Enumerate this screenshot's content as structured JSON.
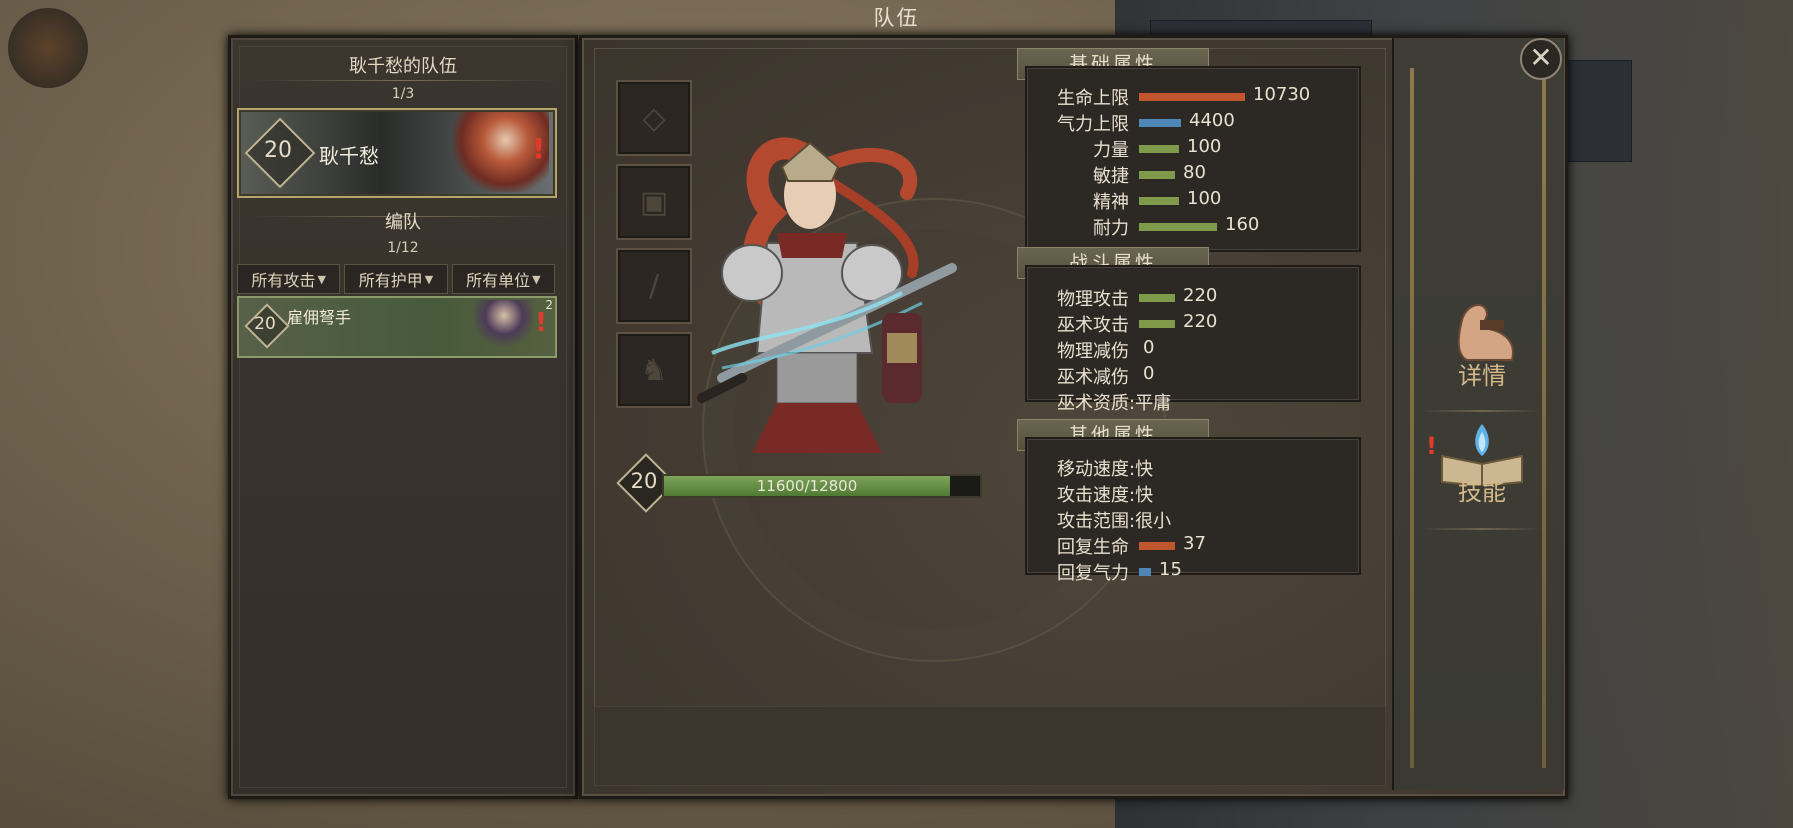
{
  "window": {
    "title": "队伍"
  },
  "left": {
    "team_title": "耿千愁的队伍",
    "team_count": "1/3",
    "hero": {
      "level": "20",
      "name": "耿千愁",
      "alert": "!"
    },
    "formation_label": "编队",
    "formation_count": "1/12",
    "filters": [
      "所有攻击",
      "所有护甲",
      "所有单位"
    ],
    "unit": {
      "level": "20",
      "name": "雇佣弩手",
      "badge": "2",
      "alert": "!"
    }
  },
  "main": {
    "character": {
      "level": "20",
      "hp_text": "11600/12800",
      "hp_fraction": 0.906
    },
    "basic": {
      "title": "基础属性",
      "rows": [
        {
          "label": "生命上限",
          "value": "10730",
          "color": "#c0552e"
        },
        {
          "label": "气力上限",
          "value": "4400",
          "color": "#4f86b8"
        },
        {
          "label": "力量",
          "value": "100",
          "color": "#7f9a4a"
        },
        {
          "label": "敏捷",
          "value": "80",
          "color": "#7f9a4a"
        },
        {
          "label": "精神",
          "value": "100",
          "color": "#7f9a4a"
        },
        {
          "label": "耐力",
          "value": "160",
          "color": "#7f9a4a"
        }
      ]
    },
    "combat": {
      "title": "战斗属性",
      "rows": [
        {
          "label": "物理攻击",
          "value": "220"
        },
        {
          "label": "巫术攻击",
          "value": "220"
        },
        {
          "label": "物理减伤",
          "value": "0"
        },
        {
          "label": "巫术减伤",
          "value": "0"
        },
        {
          "label": "巫术资质",
          "value": ":平庸"
        }
      ]
    },
    "other": {
      "title": "其他属性",
      "rows": [
        {
          "label": "移动速度",
          "value": ":快"
        },
        {
          "label": "攻击速度",
          "value": ":快"
        },
        {
          "label": "攻击范围",
          "value": ":很小"
        },
        {
          "label": "回复生命",
          "value": "37",
          "color": "#c0552e"
        },
        {
          "label": "回复气力",
          "value": "15",
          "color": "#4f86b8"
        }
      ]
    },
    "side_buttons": {
      "details": "详情",
      "skills": "技能",
      "skills_alert": "!"
    },
    "close": "✕"
  }
}
